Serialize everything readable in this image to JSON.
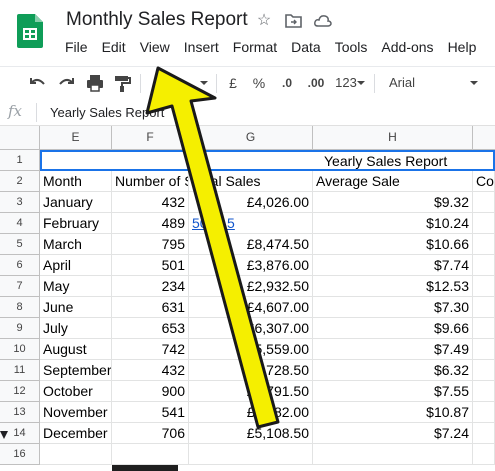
{
  "header": {
    "title": "Monthly Sales Report",
    "menu": [
      "File",
      "Edit",
      "View",
      "Insert",
      "Format",
      "Data",
      "Tools",
      "Add-ons",
      "Help"
    ]
  },
  "toolbar": {
    "currency": "£",
    "percent": "%",
    "dec_decrease": ".0",
    "dec_increase": ".00",
    "more_formats": "123",
    "font": "Arial"
  },
  "formula_bar": {
    "fx": "fx",
    "content": "Yearly Sales Report"
  },
  "grid": {
    "columns": [
      "E",
      "F",
      "G",
      "H"
    ],
    "row_numbers": [
      "1",
      "2",
      "3",
      "4",
      "5",
      "6",
      "7",
      "8",
      "9",
      "10",
      "11",
      "12",
      "13",
      "14",
      "16"
    ],
    "title_cell": "Yearly Sales Report",
    "headers": [
      "Month",
      "Number of S",
      "Total Sales",
      "Average Sale",
      "Co"
    ],
    "rows": [
      {
        "month": "January",
        "count": "432",
        "total": "£4,026.00",
        "avg": "$9.32"
      },
      {
        "month": "February",
        "count": "489",
        "total": "5006.5",
        "avg": "$10.24"
      },
      {
        "month": "March",
        "count": "795",
        "total": "£8,474.50",
        "avg": "$10.66"
      },
      {
        "month": "April",
        "count": "501",
        "total": "£3,876.00",
        "avg": "$7.74"
      },
      {
        "month": "May",
        "count": "234",
        "total": "£2,932.50",
        "avg": "$12.53"
      },
      {
        "month": "June",
        "count": "631",
        "total": "£4,607.00",
        "avg": "$7.30"
      },
      {
        "month": "July",
        "count": "653",
        "total": "£6,307.00",
        "avg": "$9.66"
      },
      {
        "month": "August",
        "count": "742",
        "total": "£5,559.00",
        "avg": "$7.49"
      },
      {
        "month": "September",
        "count": "432",
        "total": "£2,728.50",
        "avg": "$6.32"
      },
      {
        "month": "October",
        "count": "900",
        "total": "£6,791.50",
        "avg": "$7.55"
      },
      {
        "month": "November",
        "count": "541",
        "total": "£5,882.00",
        "avg": "$10.87"
      },
      {
        "month": "December",
        "count": "706",
        "total": "£5,108.50",
        "avg": "$7.24"
      }
    ]
  },
  "colors": {
    "sheets_green": "#0f9d58",
    "arrow_fill": "#f5ef00",
    "link": "#1155cc",
    "selection": "#1a73e8"
  }
}
